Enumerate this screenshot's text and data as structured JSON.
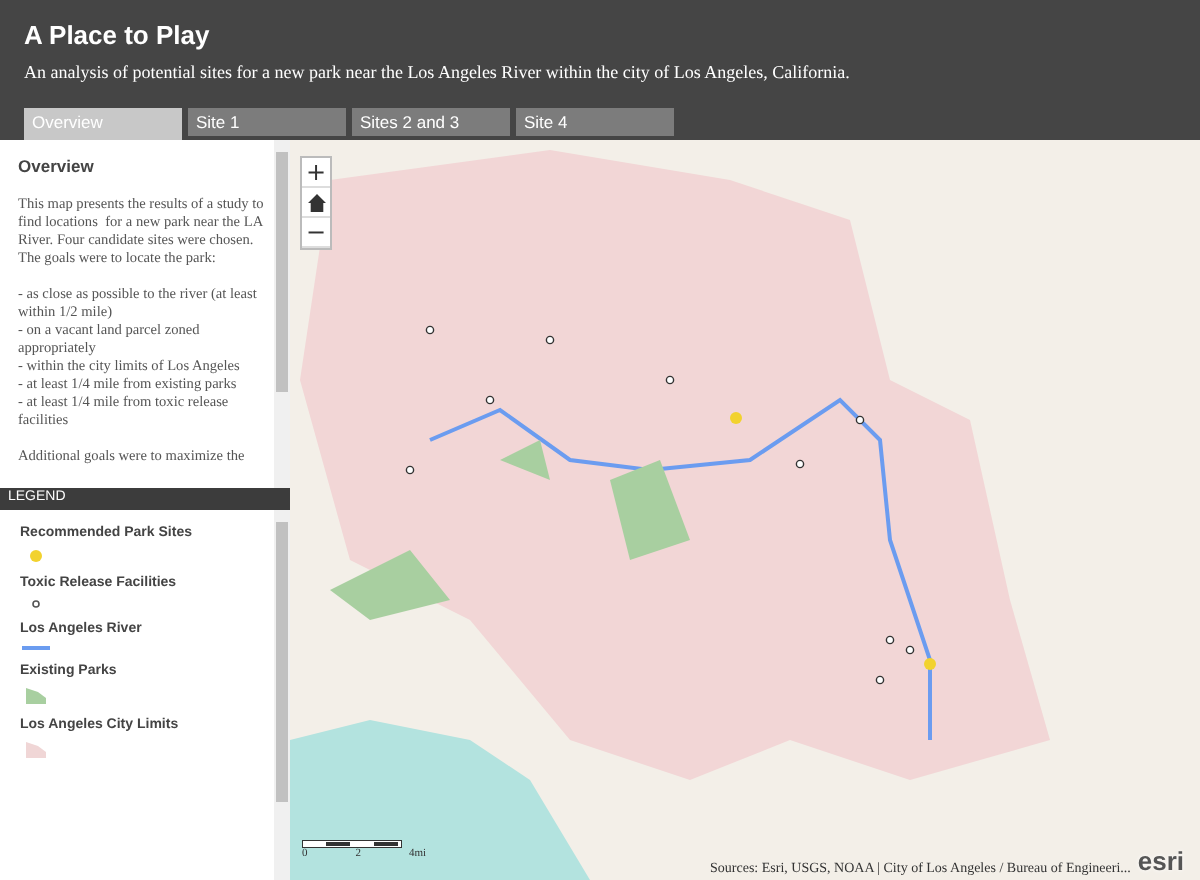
{
  "header": {
    "title": "A Place to Play",
    "subtitle": "An analysis of potential sites for a new park near the Los Angeles River within the city of Los Angeles, California."
  },
  "tabs": [
    {
      "label": "Overview",
      "selected": true
    },
    {
      "label": "Site 1",
      "selected": false
    },
    {
      "label": "Sites 2 and 3",
      "selected": false
    },
    {
      "label": "Site 4",
      "selected": false
    }
  ],
  "overview": {
    "heading": "Overview",
    "paragraphs": [
      "This map presents the results of a study to find locations  for a new park near the LA River. Four candidate sites were chosen. The goals were to locate the park:",
      "- as close as possible to the river (at least within 1/2 mile)\n- on a vacant land parcel zoned appropriately\n- within the city limits of Los Angeles\n- at least 1/4 mile from existing parks\n- at least 1/4 mile from toxic release facilities",
      "Additional goals were to maximize the"
    ]
  },
  "legend": {
    "title": "LEGEND",
    "items": [
      {
        "label": "Recommended Park Sites",
        "kind": "point",
        "color": "#f2d22e"
      },
      {
        "label": "Toxic Release Facilities",
        "kind": "circle",
        "color": "#555555"
      },
      {
        "label": "Los Angeles River",
        "kind": "line",
        "color": "#6b9cf0"
      },
      {
        "label": "Existing Parks",
        "kind": "polygon",
        "color": "#a8cfa0"
      },
      {
        "label": "Los Angeles City Limits",
        "kind": "polygon",
        "color": "#f0d6d6"
      }
    ]
  },
  "map": {
    "zoom_in": "+",
    "zoom_out": "−",
    "scale_labels": [
      "0",
      "2",
      "4mi"
    ],
    "attribution": "Sources: Esri, USGS, NOAA | City of Los Angeles / Bureau of Engineeri...",
    "logo": "esri"
  }
}
